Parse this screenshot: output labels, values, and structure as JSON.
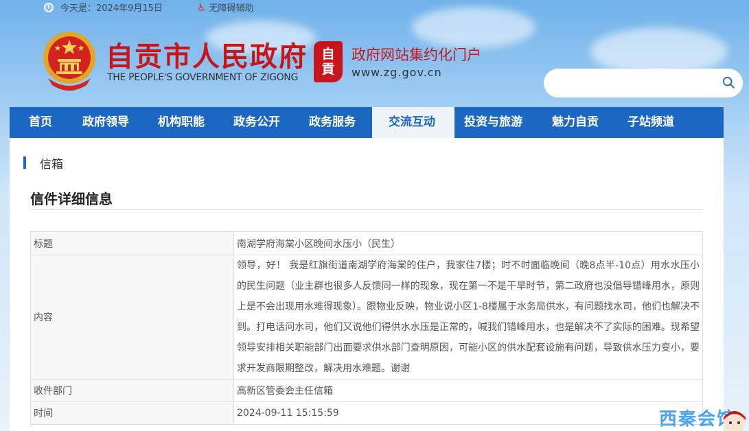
{
  "topbar": {
    "date_text": "今天是：2024年9月15日",
    "accessibility_label": "无障碍辅助"
  },
  "header": {
    "site_title": "自贡市人民政府",
    "site_subtitle": "THE PEOPLE'S GOVERNMENT OF ZIGONG",
    "logo_text_1": "自",
    "logo_text_2": "貢",
    "portal_title": "政府网站集约化门户",
    "portal_url": "www.zg.gov.cn"
  },
  "search": {
    "value": "",
    "placeholder": ""
  },
  "nav": {
    "items": [
      "首页",
      "政府领导",
      "机构职能",
      "政务公开",
      "政务服务",
      "交流互动",
      "投资与旅游",
      "魅力自贡",
      "子站频道"
    ],
    "active": "交流互动"
  },
  "breadcrumb": "信箱",
  "section_title": "信件详细信息",
  "detail": {
    "title_label": "标题",
    "title_value": "南湖学府海棠小区晚间水压小（民生）",
    "content_label": "内容",
    "content_value": "领导，好！ 我是红旗街道南湖学府海棠的住户，我家住7楼；时不时面临晚间（晚8点半-10点）用水水压小的民生问题（业主群也很多人反馈同一样的现象，现在第一不是干旱时节，第二政府也没倡导错峰用水，原则上是不会出现用水难得现象）。跟物业反映，物业说小区1-8楼属于水务局供水，有问题找水司，他们也解决不到。打电话问水司，他们又说他们得供水水压是正常的，喊我们错峰用水，也是解决不了实际的困难。现希望领导安排相关职能部门出面要求供水部门查明原因，可能小区的供水配套设施有问题，导致供水压力变小，要求开发商限期整改，解决用水难题。谢谢",
    "dept_label": "收件部门",
    "dept_value": "高新区管委会主任信箱",
    "time_label": "时间",
    "time_value": "2024-09-11 15:15:59"
  },
  "watermark": "西秦会馆",
  "colors": {
    "primary": "#1c67c2",
    "brand_red": "#c6161b"
  },
  "icons": [
    "clock-icon",
    "wheelchair-icon",
    "national-emblem-icon",
    "search-icon",
    "mascot-icon"
  ]
}
